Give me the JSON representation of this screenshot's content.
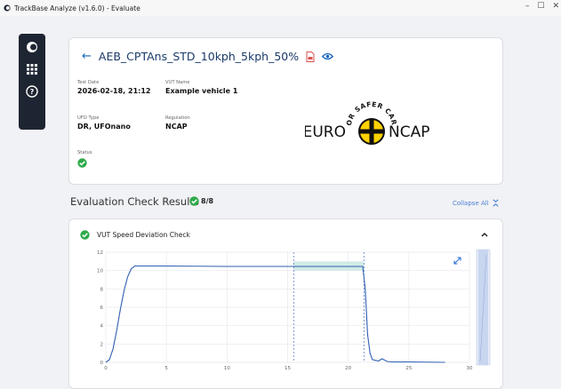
{
  "window": {
    "title": "TrackBase Analyze (v1.6.0) - Evaluate",
    "controls": [
      "–",
      "☐",
      "✕"
    ]
  },
  "sidebar": {
    "items": [
      {
        "icon": "app-logo-icon"
      },
      {
        "icon": "grid-icon"
      },
      {
        "icon": "help-icon"
      }
    ]
  },
  "evaluation": {
    "back_icon": "←",
    "title": "AEB_CPTAns_STD_10kph_5kph_50%",
    "test_date_label": "Test Date",
    "test_date": "2026-02-18, 21:12",
    "vut_name_label": "VUT Name",
    "vut_name": "Example vehicle 1",
    "ufo_type_label": "UFO Type",
    "ufo_type": "DR, UFOnano",
    "regulation_label": "Regulation",
    "regulation": "NCAP",
    "status_label": "Status",
    "status": "passed"
  },
  "logo": {
    "top_text": "FOR SAFER CARS",
    "left_text": "EURO",
    "right_text": "NCAP"
  },
  "results": {
    "title": "Evaluation Check Results",
    "badge": "8/8",
    "collapse_label": "Collapse All"
  },
  "check": {
    "title": "VUT Speed Deviation Check",
    "status": "passed"
  },
  "colors": {
    "line": "#2f5fb3",
    "band": "#cde9e2",
    "ok": "#2eaa4a",
    "accent": "#1565c0"
  },
  "chart_data": {
    "type": "line",
    "x_ticks": [
      "0",
      "5",
      "10",
      "15",
      "20",
      "25",
      "30"
    ],
    "y_ticks": [
      "0",
      "2",
      "4",
      "6",
      "8",
      "10",
      "12"
    ],
    "xlim": [
      0,
      30
    ],
    "ylim": [
      0,
      12
    ],
    "grid": true,
    "series": [
      {
        "x": [
          0,
          0.3,
          0.6,
          0.9,
          1.2,
          1.5,
          1.8,
          2.1,
          2.4,
          2.7,
          3,
          5,
          10,
          15,
          20,
          21.2,
          21.4,
          21.6,
          21.8,
          22.0,
          22.3,
          22.5,
          22.8,
          23.2,
          23.6,
          24,
          25,
          28
        ],
        "y": [
          0,
          0.3,
          1.5,
          3.5,
          5.8,
          7.8,
          9.3,
          10.2,
          10.5,
          10.5,
          10.5,
          10.5,
          10.45,
          10.45,
          10.45,
          10.45,
          8.0,
          3.0,
          1.0,
          0.3,
          0.2,
          0.15,
          0.4,
          0.1,
          0.05,
          0.05,
          0.05,
          0
        ]
      }
    ],
    "markers_x": [
      15.5,
      21.3
    ],
    "band": {
      "x": [
        15.5,
        21.3
      ],
      "y": [
        10.0,
        11.0
      ]
    },
    "scrollbar_value": 1
  }
}
